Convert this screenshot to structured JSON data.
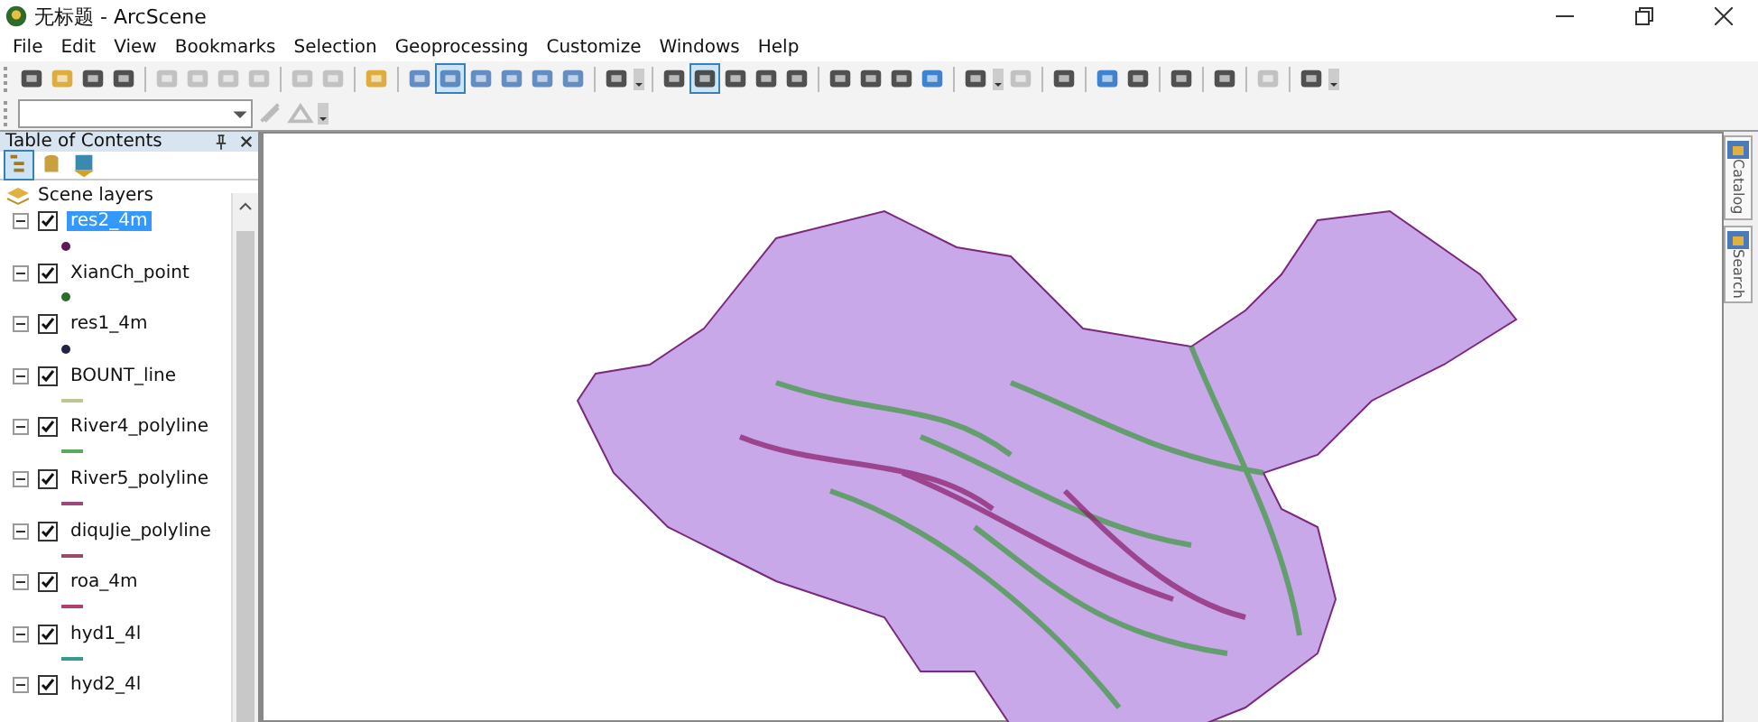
{
  "window": {
    "title": "无标题 - ArcScene"
  },
  "menu": [
    "File",
    "Edit",
    "View",
    "Bookmarks",
    "Selection",
    "Geoprocessing",
    "Customize",
    "Windows",
    "Help"
  ],
  "toc": {
    "title": "Table of Contents",
    "root": {
      "label": "Scene layers",
      "children": [
        {
          "label": "res2_4m",
          "checked": true,
          "expanded": true,
          "selected": true,
          "symbol": {
            "kind": "point",
            "color": "#5a1a5a"
          }
        },
        {
          "label": "XianCh_point",
          "checked": true,
          "expanded": true,
          "selected": false,
          "symbol": {
            "kind": "point",
            "color": "#2e6b2e"
          }
        },
        {
          "label": "res1_4m",
          "checked": true,
          "expanded": true,
          "selected": false,
          "symbol": {
            "kind": "point",
            "color": "#222244"
          }
        },
        {
          "label": "BOUNT_line",
          "checked": true,
          "expanded": true,
          "selected": false,
          "symbol": {
            "kind": "line",
            "color": "#b8c890"
          }
        },
        {
          "label": "River4_polyline",
          "checked": true,
          "expanded": true,
          "selected": false,
          "symbol": {
            "kind": "line",
            "color": "#5aaa5a"
          }
        },
        {
          "label": "River5_polyline",
          "checked": true,
          "expanded": true,
          "selected": false,
          "symbol": {
            "kind": "line",
            "color": "#9a4a7a"
          }
        },
        {
          "label": "diquJie_polyline",
          "checked": true,
          "expanded": true,
          "selected": false,
          "symbol": {
            "kind": "line",
            "color": "#9a4a6a"
          }
        },
        {
          "label": "roa_4m",
          "checked": true,
          "expanded": true,
          "selected": false,
          "symbol": {
            "kind": "line",
            "color": "#b04070"
          }
        },
        {
          "label": "hyd1_4l",
          "checked": true,
          "expanded": true,
          "selected": false,
          "symbol": {
            "kind": "line",
            "color": "#3a9a8a"
          }
        },
        {
          "label": "hyd2_4l",
          "checked": true,
          "expanded": true,
          "selected": false
        }
      ]
    }
  },
  "side_tabs": [
    "Catalog",
    "Search"
  ]
}
